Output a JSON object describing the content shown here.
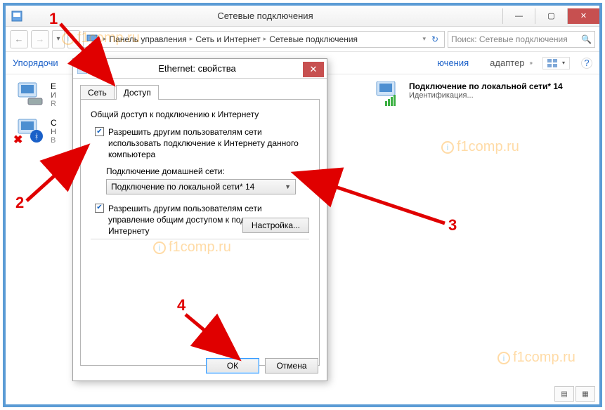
{
  "window": {
    "title": "Сетевые подключения",
    "search_placeholder": "Поиск: Сетевые подключения"
  },
  "breadcrumb": {
    "p1": "Панель управления",
    "p2": "Сеть и Интернет",
    "p3": "Сетевые подключения"
  },
  "toolbar": {
    "organize": "Упорядочи",
    "disable": "ючения",
    "d_suffix_hidden": "адаптер"
  },
  "content_right": {
    "name": "Подключение по локальной сети* 14",
    "status": "Идентификация..."
  },
  "adapters": {
    "a1_line1": "E",
    "a1_line2": "И",
    "a1_line3": "R",
    "a2_line1": "С",
    "a2_line2": "Н",
    "a2_line3": "B"
  },
  "dialog": {
    "title": "Ethernet: свойства",
    "tab_net": "Сеть",
    "tab_access": "Доступ",
    "group": "Общий доступ к подключению к Интернету",
    "chk1": "Разрешить другим пользователям сети использовать подключение к Интернету данного компьютера",
    "home_label": "Подключение домашней сети:",
    "combo_value": "Подключение по локальной сети* 14",
    "chk2": "Разрешить другим пользователям сети управление общим доступом к подключению к Интернету",
    "settings": "Настройка...",
    "ok": "ОК",
    "cancel": "Отмена"
  },
  "anno": {
    "n1": "1",
    "n2": "2",
    "n3": "3",
    "n4": "4"
  },
  "watermark": "f1comp.ru"
}
